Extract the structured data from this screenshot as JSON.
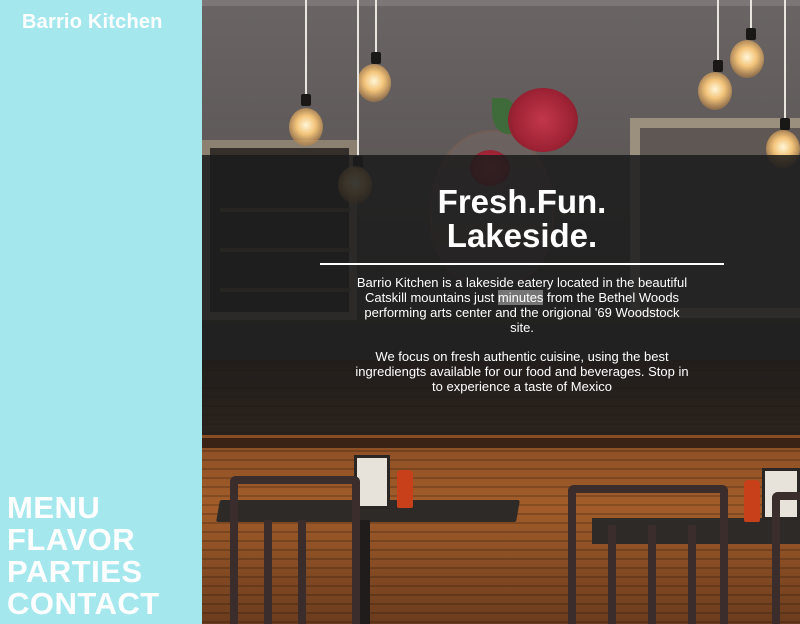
{
  "brand": {
    "name": "Barrio Kitchen"
  },
  "nav": {
    "items": [
      "MENU",
      "FLAVOR",
      "PARTIES",
      "CONTACT"
    ]
  },
  "hero": {
    "headline_line1": "Fresh.Fun.",
    "headline_line2": "Lakeside.",
    "p1_before": "Barrio Kitchen is a lakeside eatery located in the beautiful Catskill mountains just ",
    "p1_highlight": "minutes",
    "p1_after": " from the Bethel Woods performing arts center and the origional '69 Woodstock site.",
    "p2": "We focus on fresh authentic cuisine, using the best ingrediengts available for our food and beverages. Stop in to experience a taste of Mexico"
  },
  "colors": {
    "sidebar": "#a4e8ee",
    "overlay": "#1c1c1c",
    "text": "#ffffff"
  }
}
